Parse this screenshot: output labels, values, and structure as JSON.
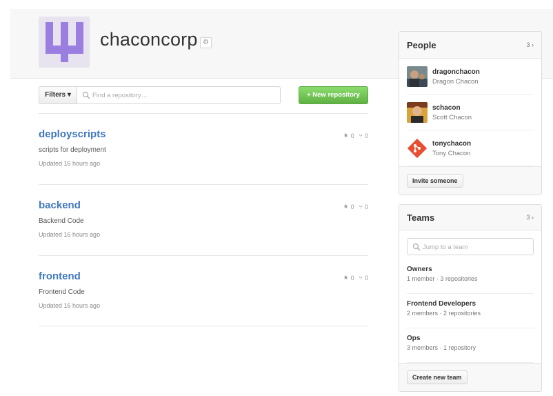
{
  "org": {
    "name": "chaconcorp",
    "settings_icon": "gear-icon",
    "avatar_color": "#9b7fe0"
  },
  "toolbar": {
    "filters_label": "Filters ▾",
    "search_placeholder": "Find a repository…",
    "new_repo_label": "+ New repository"
  },
  "repos": [
    {
      "name": "deployscripts",
      "description": "scripts for deployment",
      "updated": "Updated 16 hours ago",
      "stars": "0",
      "forks": "0"
    },
    {
      "name": "backend",
      "description": "Backend Code",
      "updated": "Updated 16 hours ago",
      "stars": "0",
      "forks": "0"
    },
    {
      "name": "frontend",
      "description": "Frontend Code",
      "updated": "Updated 16 hours ago",
      "stars": "0",
      "forks": "0"
    }
  ],
  "people": {
    "title": "People",
    "count": "3 ›",
    "members": [
      {
        "login": "dragonchacon",
        "name": "Dragon Chacon"
      },
      {
        "login": "schacon",
        "name": "Scott Chacon"
      },
      {
        "login": "tonychacon",
        "name": "Tony Chacon"
      }
    ],
    "invite_label": "Invite someone"
  },
  "teams": {
    "title": "Teams",
    "count": "3 ›",
    "search_placeholder": "Jump to a team",
    "items": [
      {
        "name": "Owners",
        "meta": "1 member · 3 repositories"
      },
      {
        "name": "Frontend Developers",
        "meta": "2 members · 2 repositories"
      },
      {
        "name": "Ops",
        "meta": "3 members · 1 repository"
      }
    ],
    "create_label": "Create new team"
  },
  "colors": {
    "link": "#4078c0",
    "new_repo_green": "#60b044",
    "git_logo": "#e84e31"
  }
}
